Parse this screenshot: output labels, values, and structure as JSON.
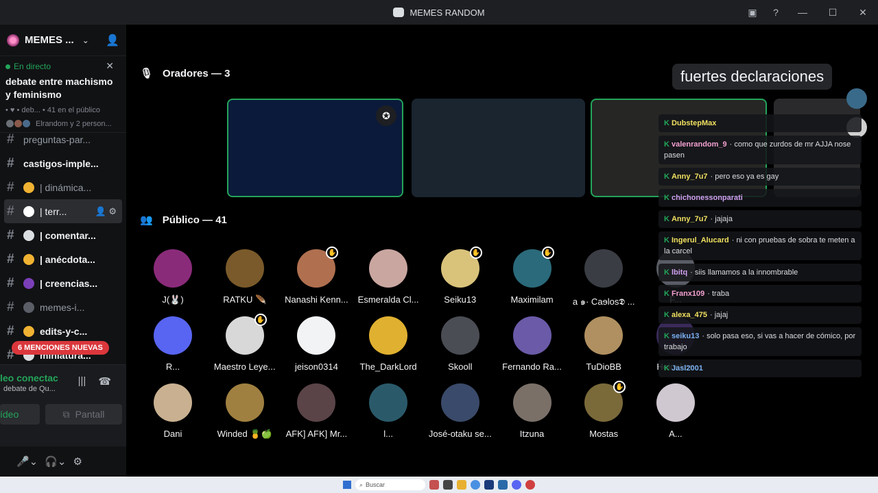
{
  "window": {
    "title": "MEMES RANDOM"
  },
  "server": {
    "name": "MEMES ..."
  },
  "live_event": {
    "status": "En directo",
    "title": "debate entre machismo y feminismo",
    "meta": "• ♥ • deb... • 41 en el público",
    "users_text": "Elrandom y 2 person..."
  },
  "channels": [
    {
      "name": "preguntas-par...",
      "style": "dim"
    },
    {
      "name": "castigos-imple...",
      "style": "bold"
    },
    {
      "name": "| dinámica...",
      "style": "normal",
      "emoji_color": "#f0b232"
    },
    {
      "name": "| terr...",
      "style": "sel",
      "emoji_color": "#ffffff"
    },
    {
      "name": "| comentar...",
      "style": "bold",
      "emoji_color": "#dbdee1"
    },
    {
      "name": "| anécdota...",
      "style": "bold",
      "emoji_color": "#f0b232"
    },
    {
      "name": "| creencias...",
      "style": "bold",
      "emoji_color": "#7b3fb8"
    },
    {
      "name": "memes-i...",
      "style": "dim",
      "emoji_color": "#5b5e66"
    },
    {
      "name": "edits-y-c...",
      "style": "bold",
      "emoji_color": "#f0b232"
    },
    {
      "name": "miniatura...",
      "style": "bold",
      "emoji_color": "#dbdee1"
    }
  ],
  "mentions_badge": "6 MENCIONES NUEVAS",
  "voice": {
    "status": "leo conectac",
    "channel": "debate de Qu...",
    "video_label": "ídeo",
    "share_label": "Pantall"
  },
  "stage": {
    "speakers_label": "Oradores — 3",
    "audience_label": "Público — 41"
  },
  "caption": "fuertes declaraciones",
  "audience": [
    {
      "name": "J(🐰)",
      "color": "#8a2b7a",
      "hand": false
    },
    {
      "name": "RATKU 🪶",
      "color": "#7a5a2a",
      "hand": false
    },
    {
      "name": "Nanashi Kenn...",
      "color": "#b07050",
      "hand": true
    },
    {
      "name": "Esmeralda Cl...",
      "color": "#c9a6a0",
      "hand": false
    },
    {
      "name": "Seiku13",
      "color": "#d9c27a",
      "hand": true
    },
    {
      "name": "Maximilam",
      "color": "#2a6a7a",
      "hand": true
    },
    {
      "name": "a ๑· Caɘlos𝕯 ...",
      "color": "#3a3d44",
      "hand": false
    },
    {
      "name": "F...",
      "color": "#5a5d66",
      "hand": false
    },
    {
      "name": "R...",
      "color": "#5865f2",
      "hand": false
    },
    {
      "name": "Maestro Leye...",
      "color": "#d8d8d8",
      "hand": true
    },
    {
      "name": "jeison0314",
      "color": "#f2f3f5",
      "hand": false
    },
    {
      "name": "The_DarkLord",
      "color": "#e0b030",
      "hand": false
    },
    {
      "name": "Skooll",
      "color": "#4a4d54",
      "hand": false
    },
    {
      "name": "Fernando Ra...",
      "color": "#6a5aa8",
      "hand": false
    },
    {
      "name": "TuDioBB",
      "color": "#b09060",
      "hand": false
    },
    {
      "name": "Heineken",
      "color": "#3a2a5a",
      "hand": false
    },
    {
      "name": "Dani",
      "color": "#c8b090",
      "hand": false
    },
    {
      "name": "Winded 🍍🍏",
      "color": "#a08040",
      "hand": false
    },
    {
      "name": "AFK] AFK] Mr...",
      "color": "#5a4448",
      "hand": false
    },
    {
      "name": "l...",
      "color": "#2a5a6a",
      "hand": false
    },
    {
      "name": "José-otaku se...",
      "color": "#3a4a6a",
      "hand": false
    },
    {
      "name": "Itzuna",
      "color": "#7a7068",
      "hand": false
    },
    {
      "name": "Mostas",
      "color": "#7a6a3a",
      "hand": true
    },
    {
      "name": "A...",
      "color": "#d0c8d0",
      "hand": false
    }
  ],
  "chat": [
    {
      "user": "DubstepMax",
      "text": "",
      "color": "#f0e060"
    },
    {
      "user": "valenrandom_9",
      "text": "como que zurdos de mr AJJA nose pasen",
      "color": "#f2a0d0"
    },
    {
      "user": "Anny_7u7",
      "text": "pero eso ya es gay",
      "color": "#f0e060"
    },
    {
      "user": "chichonessonparati",
      "text": "",
      "color": "#d0a0f0"
    },
    {
      "user": "Anny_7u7",
      "text": "jajaja",
      "color": "#f0e060"
    },
    {
      "user": "Ingerul_Alucard",
      "text": "ni con pruebas de sobra te meten a la carcel",
      "color": "#f0e060"
    },
    {
      "user": "lbitq",
      "text": "siis llamamos a la innombrable",
      "color": "#d0a0f0"
    },
    {
      "user": "Franx109",
      "text": "traba",
      "color": "#f2a0d0"
    },
    {
      "user": "alexa_475",
      "text": "jajaj",
      "color": "#f0e060"
    },
    {
      "user": "seiku13",
      "text": "solo pasa eso, si vas a hacer de cómico, por trabajo",
      "color": "#7ab0f0"
    },
    {
      "user": "Jasl2001",
      "text": "",
      "color": "#7ab0f0"
    }
  ],
  "taskbar": {
    "search": "Buscar"
  }
}
